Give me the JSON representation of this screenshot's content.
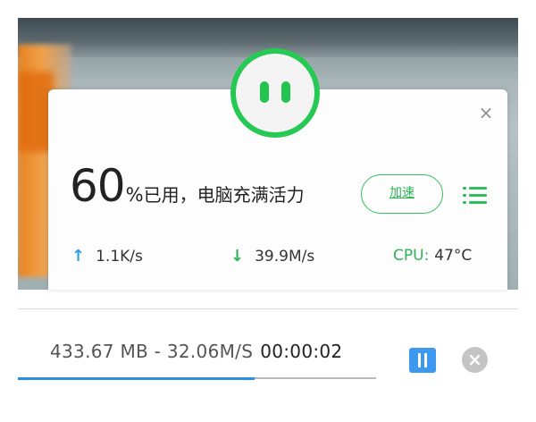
{
  "widget": {
    "usage_percent": "60",
    "usage_percent_sign": "%",
    "usage_message": "已用，电脑充满活力",
    "boost_label": "加速",
    "upload_speed": "1.1K/s",
    "download_speed": "39.9M/s",
    "cpu_label": "CPU:",
    "cpu_temp": "47°C",
    "close_glyph": "×",
    "icons": [
      "face-mascot-icon",
      "close-icon",
      "menu-list-icon",
      "upload-arrow-icon",
      "download-arrow-icon"
    ],
    "colors": {
      "accent_green": "#2db457",
      "upload_blue": "#2a9ee6"
    }
  },
  "download": {
    "size": "433.67 MB - 32.06M/S",
    "elapsed": "00:00:02",
    "progress_fraction": 0.66,
    "icons": [
      "pause-icon",
      "cancel-icon"
    ],
    "colors": {
      "progress": "#2a8fe0",
      "pause_button": "#3d98f0"
    }
  }
}
